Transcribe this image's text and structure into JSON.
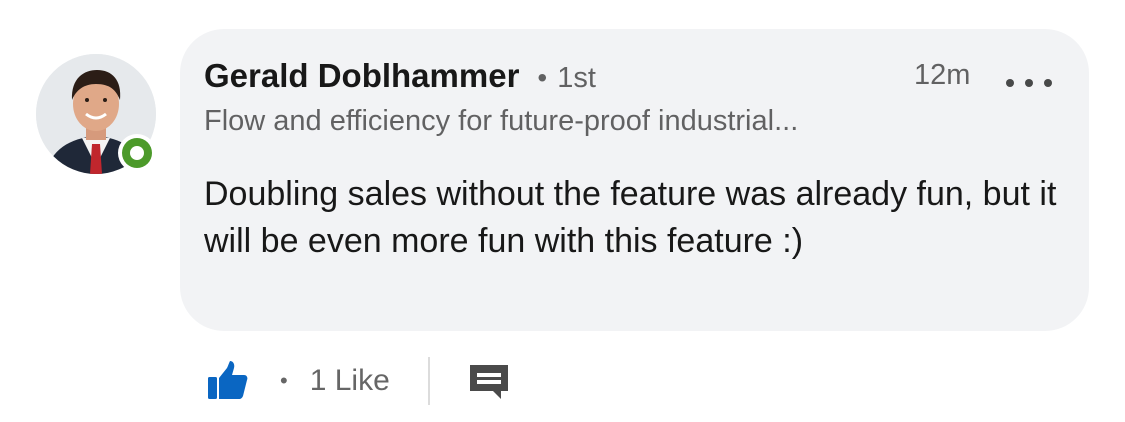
{
  "comment": {
    "author": {
      "name": "Gerald Doblhammer",
      "degree_separator": "•",
      "degree": "1st",
      "headline": "Flow and efficiency for future-proof industrial...",
      "online": true
    },
    "timestamp": "12m",
    "text": "Doubling sales without the feature was already fun, but it will be even more fun with this feature :)"
  },
  "actions": {
    "like_icon": "thumbs-up-icon",
    "separator": "•",
    "like_count": "1 Like",
    "reply_icon": "comment-icon",
    "more_icon": "ellipsis-icon"
  },
  "colors": {
    "bubble": "#f2f3f5",
    "like_blue": "#0a66c2",
    "online_green": "#4c9a2a",
    "text_primary": "#191919",
    "text_secondary": "#666666"
  }
}
